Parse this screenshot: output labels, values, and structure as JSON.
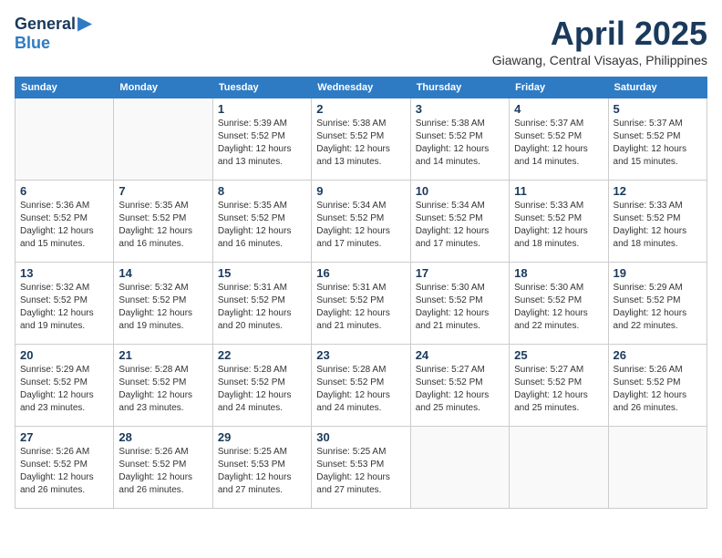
{
  "logo": {
    "general": "General",
    "blue": "Blue"
  },
  "title": {
    "month_year": "April 2025",
    "location": "Giawang, Central Visayas, Philippines"
  },
  "header_days": [
    "Sunday",
    "Monday",
    "Tuesday",
    "Wednesday",
    "Thursday",
    "Friday",
    "Saturday"
  ],
  "weeks": [
    [
      {
        "day": "",
        "info": ""
      },
      {
        "day": "",
        "info": ""
      },
      {
        "day": "1",
        "info": "Sunrise: 5:39 AM\nSunset: 5:52 PM\nDaylight: 12 hours\nand 13 minutes."
      },
      {
        "day": "2",
        "info": "Sunrise: 5:38 AM\nSunset: 5:52 PM\nDaylight: 12 hours\nand 13 minutes."
      },
      {
        "day": "3",
        "info": "Sunrise: 5:38 AM\nSunset: 5:52 PM\nDaylight: 12 hours\nand 14 minutes."
      },
      {
        "day": "4",
        "info": "Sunrise: 5:37 AM\nSunset: 5:52 PM\nDaylight: 12 hours\nand 14 minutes."
      },
      {
        "day": "5",
        "info": "Sunrise: 5:37 AM\nSunset: 5:52 PM\nDaylight: 12 hours\nand 15 minutes."
      }
    ],
    [
      {
        "day": "6",
        "info": "Sunrise: 5:36 AM\nSunset: 5:52 PM\nDaylight: 12 hours\nand 15 minutes."
      },
      {
        "day": "7",
        "info": "Sunrise: 5:35 AM\nSunset: 5:52 PM\nDaylight: 12 hours\nand 16 minutes."
      },
      {
        "day": "8",
        "info": "Sunrise: 5:35 AM\nSunset: 5:52 PM\nDaylight: 12 hours\nand 16 minutes."
      },
      {
        "day": "9",
        "info": "Sunrise: 5:34 AM\nSunset: 5:52 PM\nDaylight: 12 hours\nand 17 minutes."
      },
      {
        "day": "10",
        "info": "Sunrise: 5:34 AM\nSunset: 5:52 PM\nDaylight: 12 hours\nand 17 minutes."
      },
      {
        "day": "11",
        "info": "Sunrise: 5:33 AM\nSunset: 5:52 PM\nDaylight: 12 hours\nand 18 minutes."
      },
      {
        "day": "12",
        "info": "Sunrise: 5:33 AM\nSunset: 5:52 PM\nDaylight: 12 hours\nand 18 minutes."
      }
    ],
    [
      {
        "day": "13",
        "info": "Sunrise: 5:32 AM\nSunset: 5:52 PM\nDaylight: 12 hours\nand 19 minutes."
      },
      {
        "day": "14",
        "info": "Sunrise: 5:32 AM\nSunset: 5:52 PM\nDaylight: 12 hours\nand 19 minutes."
      },
      {
        "day": "15",
        "info": "Sunrise: 5:31 AM\nSunset: 5:52 PM\nDaylight: 12 hours\nand 20 minutes."
      },
      {
        "day": "16",
        "info": "Sunrise: 5:31 AM\nSunset: 5:52 PM\nDaylight: 12 hours\nand 21 minutes."
      },
      {
        "day": "17",
        "info": "Sunrise: 5:30 AM\nSunset: 5:52 PM\nDaylight: 12 hours\nand 21 minutes."
      },
      {
        "day": "18",
        "info": "Sunrise: 5:30 AM\nSunset: 5:52 PM\nDaylight: 12 hours\nand 22 minutes."
      },
      {
        "day": "19",
        "info": "Sunrise: 5:29 AM\nSunset: 5:52 PM\nDaylight: 12 hours\nand 22 minutes."
      }
    ],
    [
      {
        "day": "20",
        "info": "Sunrise: 5:29 AM\nSunset: 5:52 PM\nDaylight: 12 hours\nand 23 minutes."
      },
      {
        "day": "21",
        "info": "Sunrise: 5:28 AM\nSunset: 5:52 PM\nDaylight: 12 hours\nand 23 minutes."
      },
      {
        "day": "22",
        "info": "Sunrise: 5:28 AM\nSunset: 5:52 PM\nDaylight: 12 hours\nand 24 minutes."
      },
      {
        "day": "23",
        "info": "Sunrise: 5:28 AM\nSunset: 5:52 PM\nDaylight: 12 hours\nand 24 minutes."
      },
      {
        "day": "24",
        "info": "Sunrise: 5:27 AM\nSunset: 5:52 PM\nDaylight: 12 hours\nand 25 minutes."
      },
      {
        "day": "25",
        "info": "Sunrise: 5:27 AM\nSunset: 5:52 PM\nDaylight: 12 hours\nand 25 minutes."
      },
      {
        "day": "26",
        "info": "Sunrise: 5:26 AM\nSunset: 5:52 PM\nDaylight: 12 hours\nand 26 minutes."
      }
    ],
    [
      {
        "day": "27",
        "info": "Sunrise: 5:26 AM\nSunset: 5:52 PM\nDaylight: 12 hours\nand 26 minutes."
      },
      {
        "day": "28",
        "info": "Sunrise: 5:26 AM\nSunset: 5:52 PM\nDaylight: 12 hours\nand 26 minutes."
      },
      {
        "day": "29",
        "info": "Sunrise: 5:25 AM\nSunset: 5:53 PM\nDaylight: 12 hours\nand 27 minutes."
      },
      {
        "day": "30",
        "info": "Sunrise: 5:25 AM\nSunset: 5:53 PM\nDaylight: 12 hours\nand 27 minutes."
      },
      {
        "day": "",
        "info": ""
      },
      {
        "day": "",
        "info": ""
      },
      {
        "day": "",
        "info": ""
      }
    ]
  ]
}
